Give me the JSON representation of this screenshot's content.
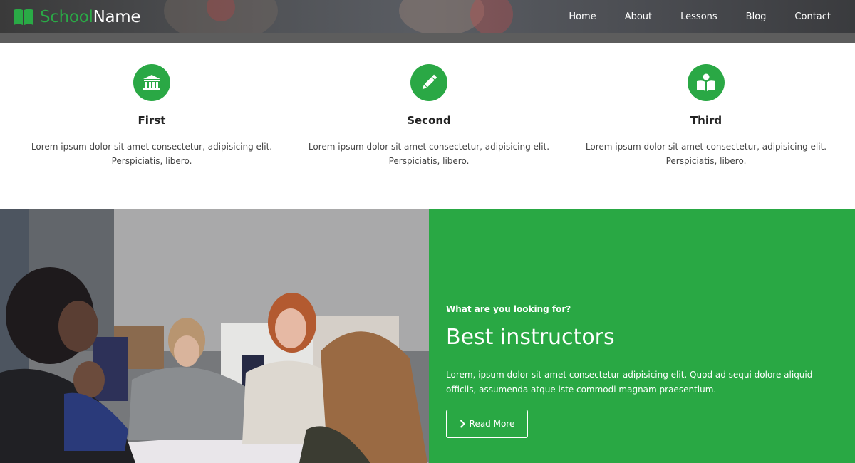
{
  "brand": {
    "school": "School",
    "name": "Name",
    "logo_icon": "book-icon",
    "accent": "#2aa845"
  },
  "nav": {
    "items": [
      {
        "label": "Home"
      },
      {
        "label": "About"
      },
      {
        "label": "Lessons"
      },
      {
        "label": "Blog"
      },
      {
        "label": "Contact"
      }
    ]
  },
  "features": [
    {
      "title": "First",
      "text": "Lorem ipsum dolor sit amet consectetur, adipisicing elit. Perspiciatis, libero.",
      "icon": "bank-icon"
    },
    {
      "title": "Second",
      "text": "Lorem ipsum dolor sit amet consectetur, adipisicing elit. Perspiciatis, libero.",
      "icon": "pencil-icon"
    },
    {
      "title": "Third",
      "text": "Lorem ipsum dolor sit amet consectetur, adipisicing elit. Perspiciatis, libero.",
      "icon": "reader-icon"
    }
  ],
  "promo": {
    "kicker": "What are you looking for?",
    "title": "Best instructors",
    "text": "Lorem, ipsum dolor sit amet consectetur adipisicing elit. Quod ad sequi dolore aliquid officiis, assumenda atque iste commodi magnam praesentium.",
    "button": "Read More",
    "button_icon": "chevron-right-icon",
    "background": "#29a844"
  }
}
